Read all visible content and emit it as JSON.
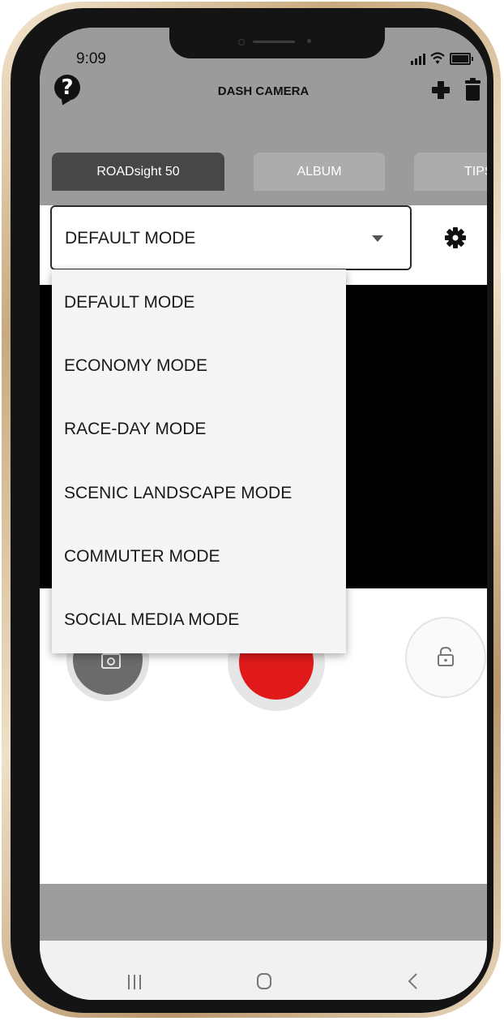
{
  "status_bar": {
    "time": "9:09"
  },
  "header": {
    "title": "DASH CAMERA"
  },
  "tabs": [
    {
      "label": "ROADsight 50",
      "active": true
    },
    {
      "label": "ALBUM",
      "active": false
    },
    {
      "label": "TIPS",
      "active": false
    }
  ],
  "mode_select": {
    "selected": "DEFAULT MODE",
    "options": [
      "DEFAULT MODE",
      "ECONOMY MODE",
      "RACE-DAY MODE",
      "SCENIC LANDSCAPE MODE",
      "COMMUTER MODE",
      "SOCIAL MEDIA MODE"
    ]
  },
  "icons": {
    "help": "question-circle-icon",
    "add": "plus-icon",
    "delete": "trash-icon",
    "settings": "gear-icon",
    "photo": "camera-icon",
    "record": "record-icon",
    "lock": "unlock-icon",
    "nav_recents": "recents-icon",
    "nav_home": "home-icon",
    "nav_back": "back-icon"
  },
  "colors": {
    "header_bg": "#9b9b9b",
    "tab_active_bg": "#474747",
    "tab_inactive_bg": "#acacac",
    "record": "#e01a1a",
    "video_bg": "#000000"
  }
}
